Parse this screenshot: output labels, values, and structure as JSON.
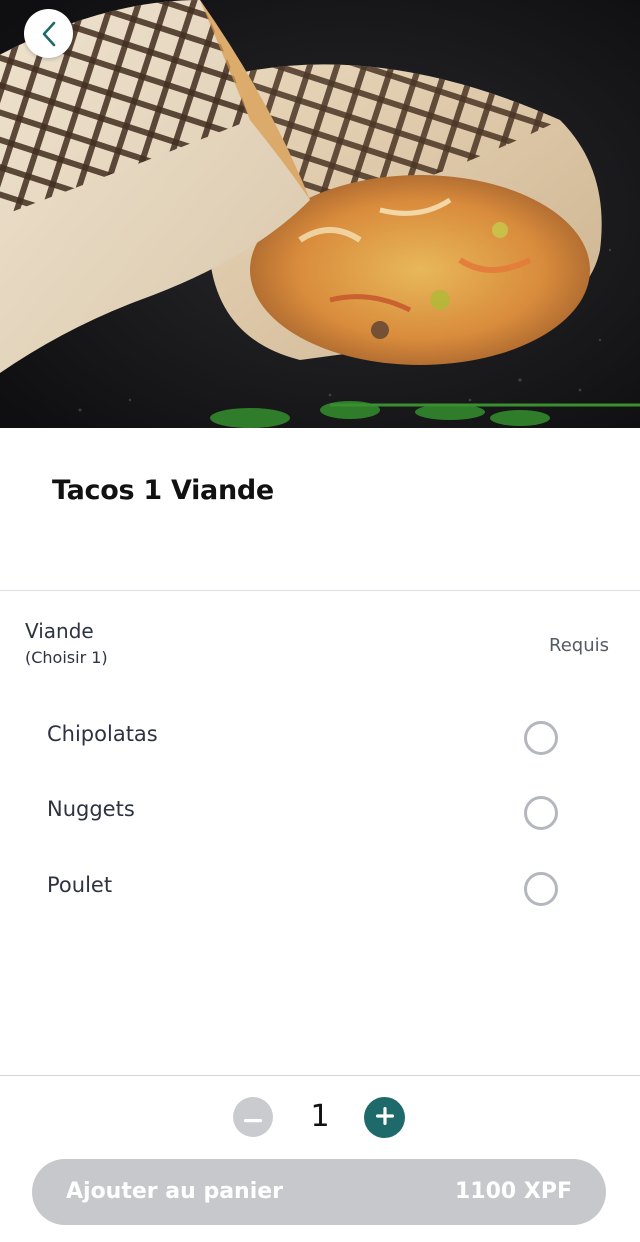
{
  "product": {
    "title": "Tacos 1 Viande",
    "image_icon": "tacos-photo"
  },
  "nav": {
    "back_icon": "chevron-left-icon"
  },
  "option_group": {
    "name": "Viande",
    "hint": "(Choisir 1)",
    "requirement": "Requis",
    "options": [
      {
        "label": "Chipolatas",
        "selected": false
      },
      {
        "label": "Nuggets",
        "selected": false
      },
      {
        "label": "Poulet",
        "selected": false
      }
    ]
  },
  "footer": {
    "quantity": "1",
    "add_label": "Ajouter au panier",
    "price": "1100 XPF"
  },
  "colors": {
    "accent": "#1e6a6a",
    "disabled": "#c7c8cb",
    "text": "#2d3340"
  }
}
